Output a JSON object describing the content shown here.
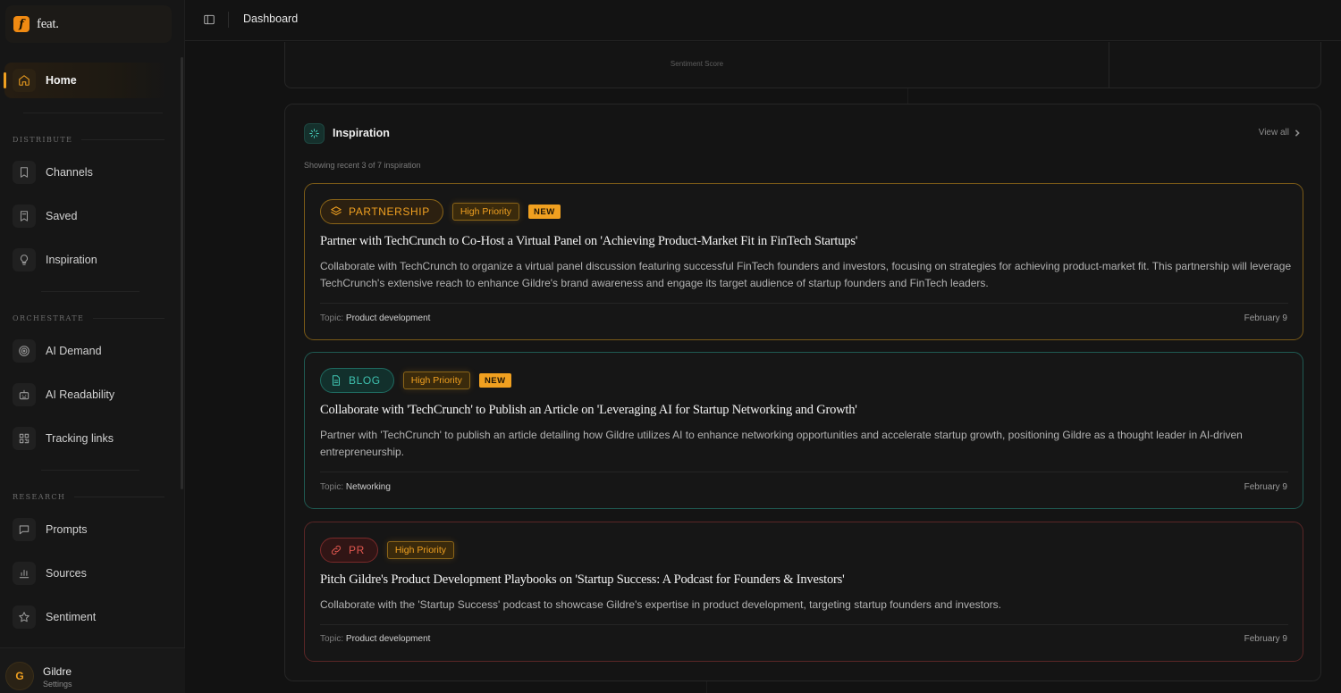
{
  "app": {
    "brand_name": "feat.",
    "brand_logo_letter": "f"
  },
  "sidebar": {
    "home": {
      "label": "Home",
      "icon": "home-icon"
    },
    "sections": [
      {
        "label": "DISTRIBUTE",
        "items": [
          {
            "label": "Channels",
            "icon": "bookmark-icon"
          },
          {
            "label": "Saved",
            "icon": "bookmark-outline-icon"
          },
          {
            "label": "Inspiration",
            "icon": "lightbulb-icon"
          }
        ]
      },
      {
        "label": "ORCHESTRATE",
        "items": [
          {
            "label": "AI Demand",
            "icon": "target-icon"
          },
          {
            "label": "AI Readability",
            "icon": "robot-icon"
          },
          {
            "label": "Tracking links",
            "icon": "qr-icon"
          }
        ]
      },
      {
        "label": "RESEARCH",
        "items": [
          {
            "label": "Prompts",
            "icon": "message-icon"
          },
          {
            "label": "Sources",
            "icon": "bar-chart-icon"
          },
          {
            "label": "Sentiment",
            "icon": "star-icon"
          }
        ]
      }
    ],
    "user": {
      "initial": "G",
      "name": "Gildre",
      "subtitle": "Settings"
    }
  },
  "topbar": {
    "breadcrumb": "Dashboard"
  },
  "sentiment_card": {
    "caption": "Sentiment Score"
  },
  "inspiration": {
    "title": "Inspiration",
    "view_all": "View all",
    "subtitle": "Showing recent 3 of 7 inspiration",
    "topic_prefix": "Topic:",
    "items": [
      {
        "type": "PARTNERSHIP",
        "priority": "High Priority",
        "new_tag": "NEW",
        "title": "Partner with TechCrunch to Co-Host a Virtual Panel on 'Achieving Product-Market Fit in FinTech Startups'",
        "description": "Collaborate with TechCrunch to organize a virtual panel discussion featuring successful FinTech founders and investors, focusing on strategies for achieving product-market fit. This partnership will leverage TechCrunch's extensive reach to enhance Gildre's brand awareness and engage its target audience of startup founders and FinTech leaders.",
        "topic": "Product development",
        "date": "February 9",
        "accent": "#f0a020"
      },
      {
        "type": "BLOG",
        "priority": "High Priority",
        "new_tag": "NEW",
        "title": "Collaborate with 'TechCrunch' to Publish an Article on 'Leveraging AI for Startup Networking and Growth'",
        "description": "Partner with 'TechCrunch' to publish an article detailing how Gildre utilizes AI to enhance networking opportunities and accelerate startup growth, positioning Gildre as a thought leader in AI-driven entrepreneurship.",
        "topic": "Networking",
        "date": "February 9",
        "accent": "#3fc2b0"
      },
      {
        "type": "PR",
        "priority": "High Priority",
        "title": "Pitch Gildre's Product Development Playbooks on 'Startup Success: A Podcast for Founders & Investors'",
        "description": "Collaborate with the 'Startup Success' podcast to showcase Gildre's expertise in product development, targeting startup founders and investors.",
        "topic": "Product development",
        "date": "February 9",
        "accent": "#e0574f"
      }
    ]
  }
}
